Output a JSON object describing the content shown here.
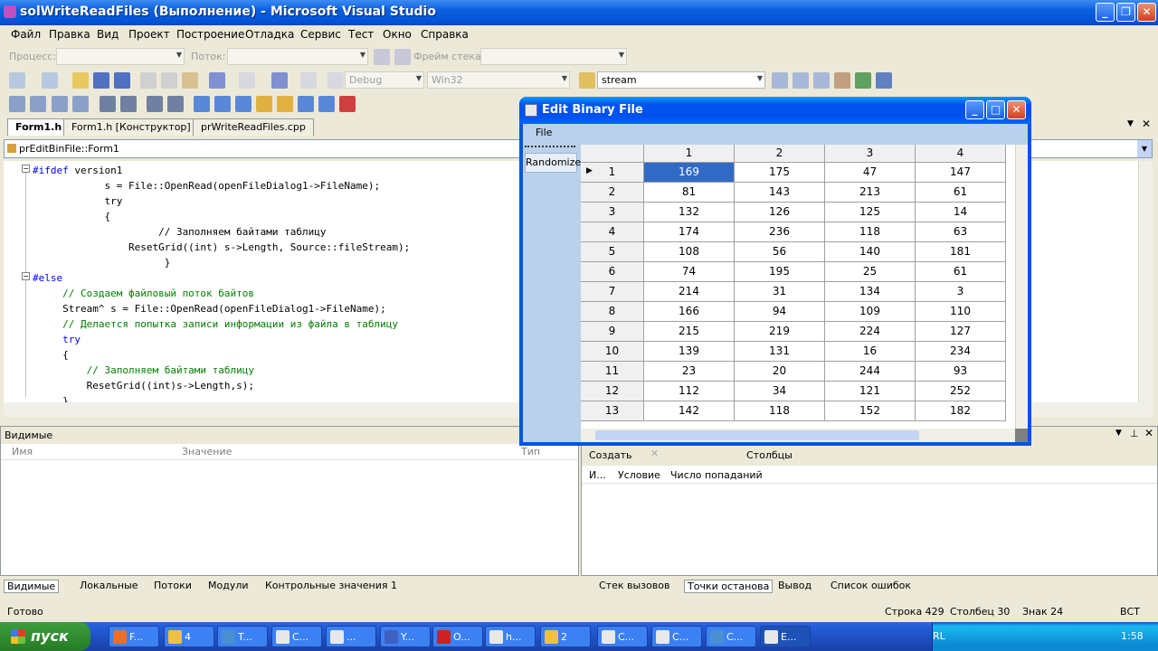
{
  "window": {
    "title": "solWriteReadFiles (Выполнение) - Microsoft Visual Studio"
  },
  "menu": [
    "Файл",
    "Правка",
    "Вид",
    "Проект",
    "Построение",
    "Отладка",
    "Сервис",
    "Тест",
    "Окно",
    "Справка"
  ],
  "debug_toolbar": {
    "process_label": "Процесс:",
    "thread_label": "Поток:",
    "frame_label": "Фрейм стека:"
  },
  "std_toolbar": {
    "config": "Debug",
    "platform": "Win32",
    "find_value": "stream"
  },
  "doc_tabs": [
    "Form1.h",
    "Form1.h [Конструктор]",
    "prWriteReadFiles.cpp"
  ],
  "nav_bar": {
    "scope": "prEditBinFile::Form1"
  },
  "code_lines": [
    {
      "t": "#ifdef",
      "c": "kw",
      "rest": " version1"
    },
    {
      "t": "            s = File::OpenRead(openFileDialog1->FileName);",
      "c": ""
    },
    {
      "t": "            try",
      "c": ""
    },
    {
      "t": "            {",
      "c": ""
    },
    {
      "t": "                     // Заполняем байтами таблицу",
      "c": ""
    },
    {
      "t": "                ResetGrid((int) s->Length, Source::fileStream);",
      "c": ""
    },
    {
      "t": "                      }",
      "c": ""
    },
    {
      "t": "#else",
      "c": "kw",
      "rest": ""
    },
    {
      "t": "     // Создаем файловый поток байтов",
      "c": "cm"
    },
    {
      "t": "     Stream^ s = File::OpenRead(openFileDialog1->FileName);",
      "c": ""
    },
    {
      "t": "     // Делается попытка записи информации из файла в таблицу",
      "c": "cm"
    },
    {
      "t": "     try",
      "c": "kw"
    },
    {
      "t": "     {",
      "c": ""
    },
    {
      "t": "         // Заполняем байтами таблицу",
      "c": "cm"
    },
    {
      "t": "         ResetGrid((int)s->Length,s);",
      "c": ""
    },
    {
      "t": "     }",
      "c": ""
    }
  ],
  "autos_panel": {
    "title": "Видимые",
    "col_name": "Имя",
    "col_value": "Значение",
    "col_type": "Тип"
  },
  "breakpoints_panel": {
    "create": "Создать",
    "columns": "Столбцы",
    "col_name": "И...",
    "col_condition": "Условие",
    "col_hits": "Число попаданий"
  },
  "bottom_left_tabs": [
    "Видимые",
    "Локальные",
    "Потоки",
    "Модули",
    "Контрольные значения 1"
  ],
  "bottom_right_tabs": [
    "Стек вызовов",
    "Точки останова",
    "Вывод",
    "Список ошибок"
  ],
  "status": {
    "ready": "Готово",
    "line": "Строка 429",
    "col": "Столбец 30",
    "char": "Знак 24",
    "mode": "ВСТ"
  },
  "dialog": {
    "title": "Edit Binary File",
    "menu_file": "File",
    "side_button": "Randomize",
    "columns": [
      "1",
      "2",
      "3",
      "4"
    ],
    "rows": [
      {
        "n": "1",
        "v": [
          169,
          175,
          47,
          147
        ]
      },
      {
        "n": "2",
        "v": [
          81,
          143,
          213,
          61
        ]
      },
      {
        "n": "3",
        "v": [
          132,
          126,
          125,
          14
        ]
      },
      {
        "n": "4",
        "v": [
          174,
          236,
          118,
          63
        ]
      },
      {
        "n": "5",
        "v": [
          108,
          56,
          140,
          181
        ]
      },
      {
        "n": "6",
        "v": [
          74,
          195,
          25,
          61
        ]
      },
      {
        "n": "7",
        "v": [
          214,
          31,
          134,
          3
        ]
      },
      {
        "n": "8",
        "v": [
          166,
          94,
          109,
          110
        ]
      },
      {
        "n": "9",
        "v": [
          215,
          219,
          224,
          127
        ]
      },
      {
        "n": "10",
        "v": [
          139,
          131,
          16,
          234
        ]
      },
      {
        "n": "11",
        "v": [
          23,
          20,
          244,
          93
        ]
      },
      {
        "n": "12",
        "v": [
          112,
          34,
          121,
          252
        ]
      },
      {
        "n": "13",
        "v": [
          142,
          118,
          152,
          182
        ]
      }
    ]
  },
  "taskbar": {
    "start": "пуск",
    "items": [
      "F...",
      "4",
      "T...",
      "C...",
      "...",
      "Y...",
      "O...",
      "h...",
      "2",
      "C...",
      "C...",
      "C...",
      "E..."
    ],
    "lang": "RL",
    "clock": "1:58"
  }
}
